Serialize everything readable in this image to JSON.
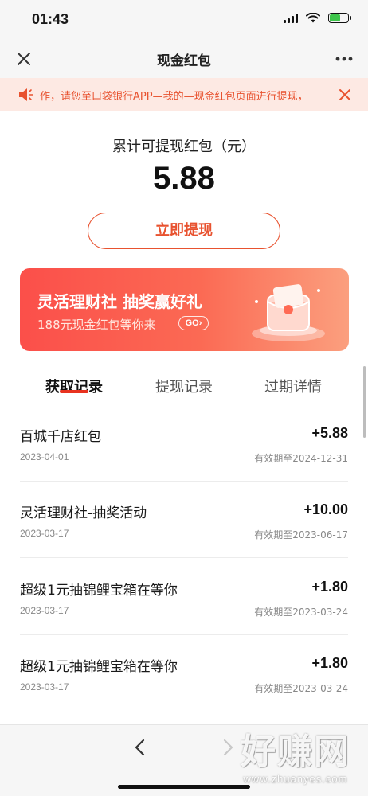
{
  "status_bar": {
    "time": "01:43"
  },
  "nav": {
    "title": "现金红包"
  },
  "notice": {
    "text": "作，请您至口袋银行APP—我的—现金红包页面进行提现，"
  },
  "summary": {
    "label": "累计可提现红包（元）",
    "amount": "5.88",
    "withdraw_label": "立即提现"
  },
  "banner": {
    "title": "灵活理财社 抽奖赢好礼",
    "subtitle": "188元现金红包等你来",
    "go_label": "GO"
  },
  "tabs": [
    {
      "label": "获取记录",
      "active": true
    },
    {
      "label": "提现记录",
      "active": false
    },
    {
      "label": "过期详情",
      "active": false
    }
  ],
  "records": [
    {
      "title": "百城千店红包",
      "date": "2023-04-01",
      "amount": "+5.88",
      "expiry": "有效期至2024-12-31"
    },
    {
      "title": "灵活理财社-抽奖活动",
      "date": "2023-03-17",
      "amount": "+10.00",
      "expiry": "有效期至2023-06-17"
    },
    {
      "title": "超级1元抽锦鲤宝箱在等你",
      "date": "2023-03-17",
      "amount": "+1.80",
      "expiry": "有效期至2023-03-24"
    },
    {
      "title": "超级1元抽锦鲤宝箱在等你",
      "date": "2023-03-17",
      "amount": "+1.80",
      "expiry": "有效期至2023-03-24"
    }
  ],
  "watermark": {
    "main": "好赚网",
    "url": "www.zhuanyes.com"
  },
  "colors": {
    "accent": "#e8522f",
    "tab_underline": "#e8321f",
    "banner_start": "#fb4f4a",
    "banner_end": "#fb9f7e"
  }
}
